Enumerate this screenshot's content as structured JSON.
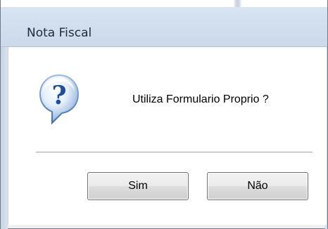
{
  "window": {
    "title": "Nota Fiscal"
  },
  "dialog": {
    "icon": "question-icon",
    "message": "Utiliza Formulario Proprio ?",
    "buttons": {
      "yes_label": "Sim",
      "no_label": "Não"
    }
  },
  "colors": {
    "titlebar": "#d3e0ef",
    "content_background": "#ffffff",
    "button_border": "#707070",
    "icon_blue": "#2f6fb9"
  }
}
